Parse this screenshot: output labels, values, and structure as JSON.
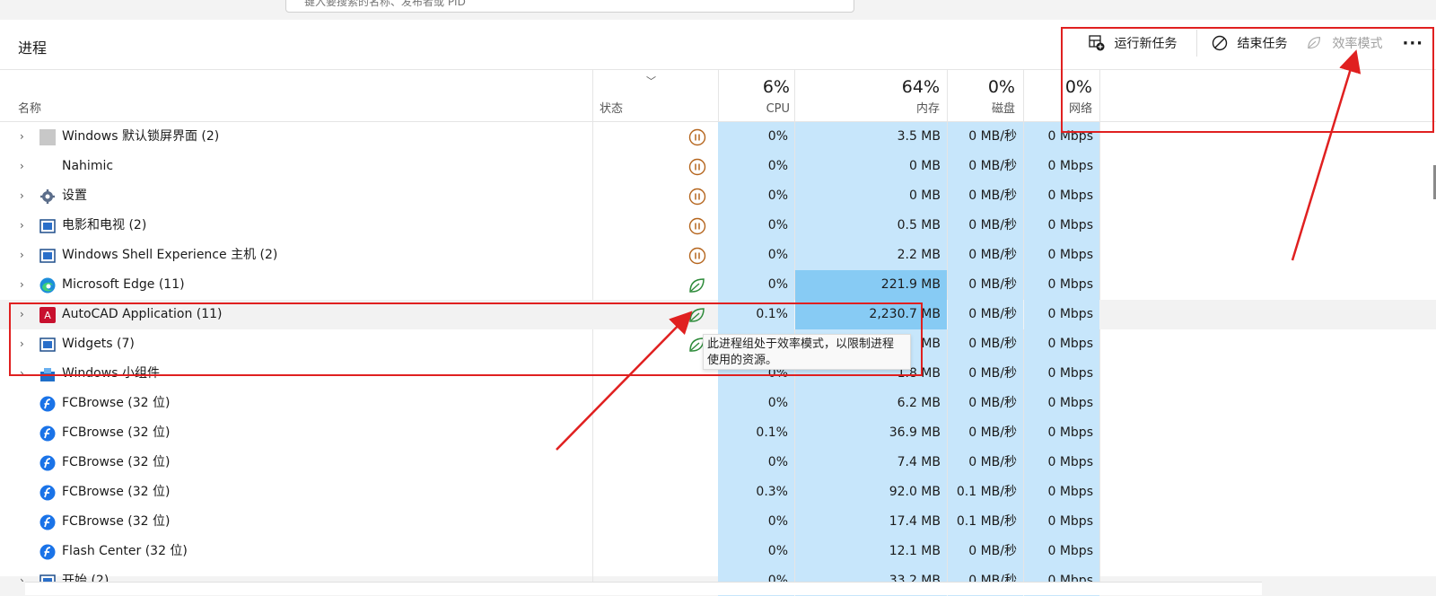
{
  "search": {
    "placeholder": "键入要搜索的名称、发布者或 PID"
  },
  "page": {
    "title": "进程"
  },
  "toolbar": {
    "run_new_task": "运行新任务",
    "end_task": "结束任务",
    "efficiency_mode": "效率模式",
    "more": "···"
  },
  "columns": {
    "name": "名称",
    "status": "状态",
    "cpu": {
      "label": "CPU",
      "pct": "6%"
    },
    "memory": {
      "label": "内存",
      "pct": "64%"
    },
    "disk": {
      "label": "磁盘",
      "pct": "0%"
    },
    "network": {
      "label": "网络",
      "pct": "0%"
    }
  },
  "rows": [
    {
      "name": "Windows 默认锁屏界面 (2)",
      "icon": "lockscreen-icon",
      "status": "paused-icon",
      "cpu": "0%",
      "mem": "3.5 MB",
      "disk": "0 MB/秒",
      "net": "0 Mbps"
    },
    {
      "name": "Nahimic",
      "icon": "none",
      "status": "paused-icon",
      "cpu": "0%",
      "mem": "0 MB",
      "disk": "0 MB/秒",
      "net": "0 Mbps"
    },
    {
      "name": "设置",
      "icon": "gear-icon",
      "status": "paused-icon",
      "cpu": "0%",
      "mem": "0 MB",
      "disk": "0 MB/秒",
      "net": "0 Mbps"
    },
    {
      "name": "电影和电视 (2)",
      "icon": "window-icon",
      "status": "paused-icon",
      "cpu": "0%",
      "mem": "0.5 MB",
      "disk": "0 MB/秒",
      "net": "0 Mbps"
    },
    {
      "name": "Windows Shell Experience 主机 (2)",
      "icon": "window-icon",
      "status": "paused-icon",
      "cpu": "0%",
      "mem": "2.2 MB",
      "disk": "0 MB/秒",
      "net": "0 Mbps"
    },
    {
      "name": "Microsoft Edge (11)",
      "icon": "edge-icon",
      "status": "leaf-icon",
      "cpu": "0%",
      "mem": "221.9 MB",
      "disk": "0 MB/秒",
      "net": "0 Mbps"
    },
    {
      "name": "AutoCAD Application (11)",
      "icon": "autocad-icon",
      "status": "leaf-icon",
      "cpu": "0.1%",
      "mem": "2,230.7 MB",
      "disk": "0 MB/秒",
      "net": "0 Mbps"
    },
    {
      "name": "Widgets (7)",
      "icon": "window-icon",
      "status": "leaf-icon",
      "cpu": "0%",
      "mem": "MB",
      "disk": "0 MB/秒",
      "net": "0 Mbps"
    },
    {
      "name": "Windows 小组件",
      "icon": "widget-icon",
      "status": "",
      "cpu": "0%",
      "mem": "1.8 MB",
      "disk": "0 MB/秒",
      "net": "0 Mbps"
    },
    {
      "name": "FCBrowse (32 位)",
      "icon": "flash-icon",
      "status": "",
      "cpu": "0%",
      "mem": "6.2 MB",
      "disk": "0 MB/秒",
      "net": "0 Mbps"
    },
    {
      "name": "FCBrowse (32 位)",
      "icon": "flash-icon",
      "status": "",
      "cpu": "0.1%",
      "mem": "36.9 MB",
      "disk": "0 MB/秒",
      "net": "0 Mbps"
    },
    {
      "name": "FCBrowse (32 位)",
      "icon": "flash-icon",
      "status": "",
      "cpu": "0%",
      "mem": "7.4 MB",
      "disk": "0 MB/秒",
      "net": "0 Mbps"
    },
    {
      "name": "FCBrowse (32 位)",
      "icon": "flash-icon",
      "status": "",
      "cpu": "0.3%",
      "mem": "92.0 MB",
      "disk": "0.1 MB/秒",
      "net": "0 Mbps"
    },
    {
      "name": "FCBrowse (32 位)",
      "icon": "flash-icon",
      "status": "",
      "cpu": "0%",
      "mem": "17.4 MB",
      "disk": "0.1 MB/秒",
      "net": "0 Mbps"
    },
    {
      "name": "Flash Center (32 位)",
      "icon": "flash-icon",
      "status": "",
      "cpu": "0%",
      "mem": "12.1 MB",
      "disk": "0 MB/秒",
      "net": "0 Mbps"
    },
    {
      "name": "开始 (2)",
      "icon": "window-icon",
      "status": "",
      "cpu": "0%",
      "mem": "33.2 MB",
      "disk": "0 MB/秒",
      "net": "0 Mbps"
    }
  ],
  "tooltip": {
    "line1": "此进程组处于效率模式，以限制进程",
    "line2": "使用的资源。"
  },
  "colors": {
    "accent_red": "#e02020",
    "col_bg": "#c7e6fb",
    "col_bg_hi": "#87cbf4"
  }
}
